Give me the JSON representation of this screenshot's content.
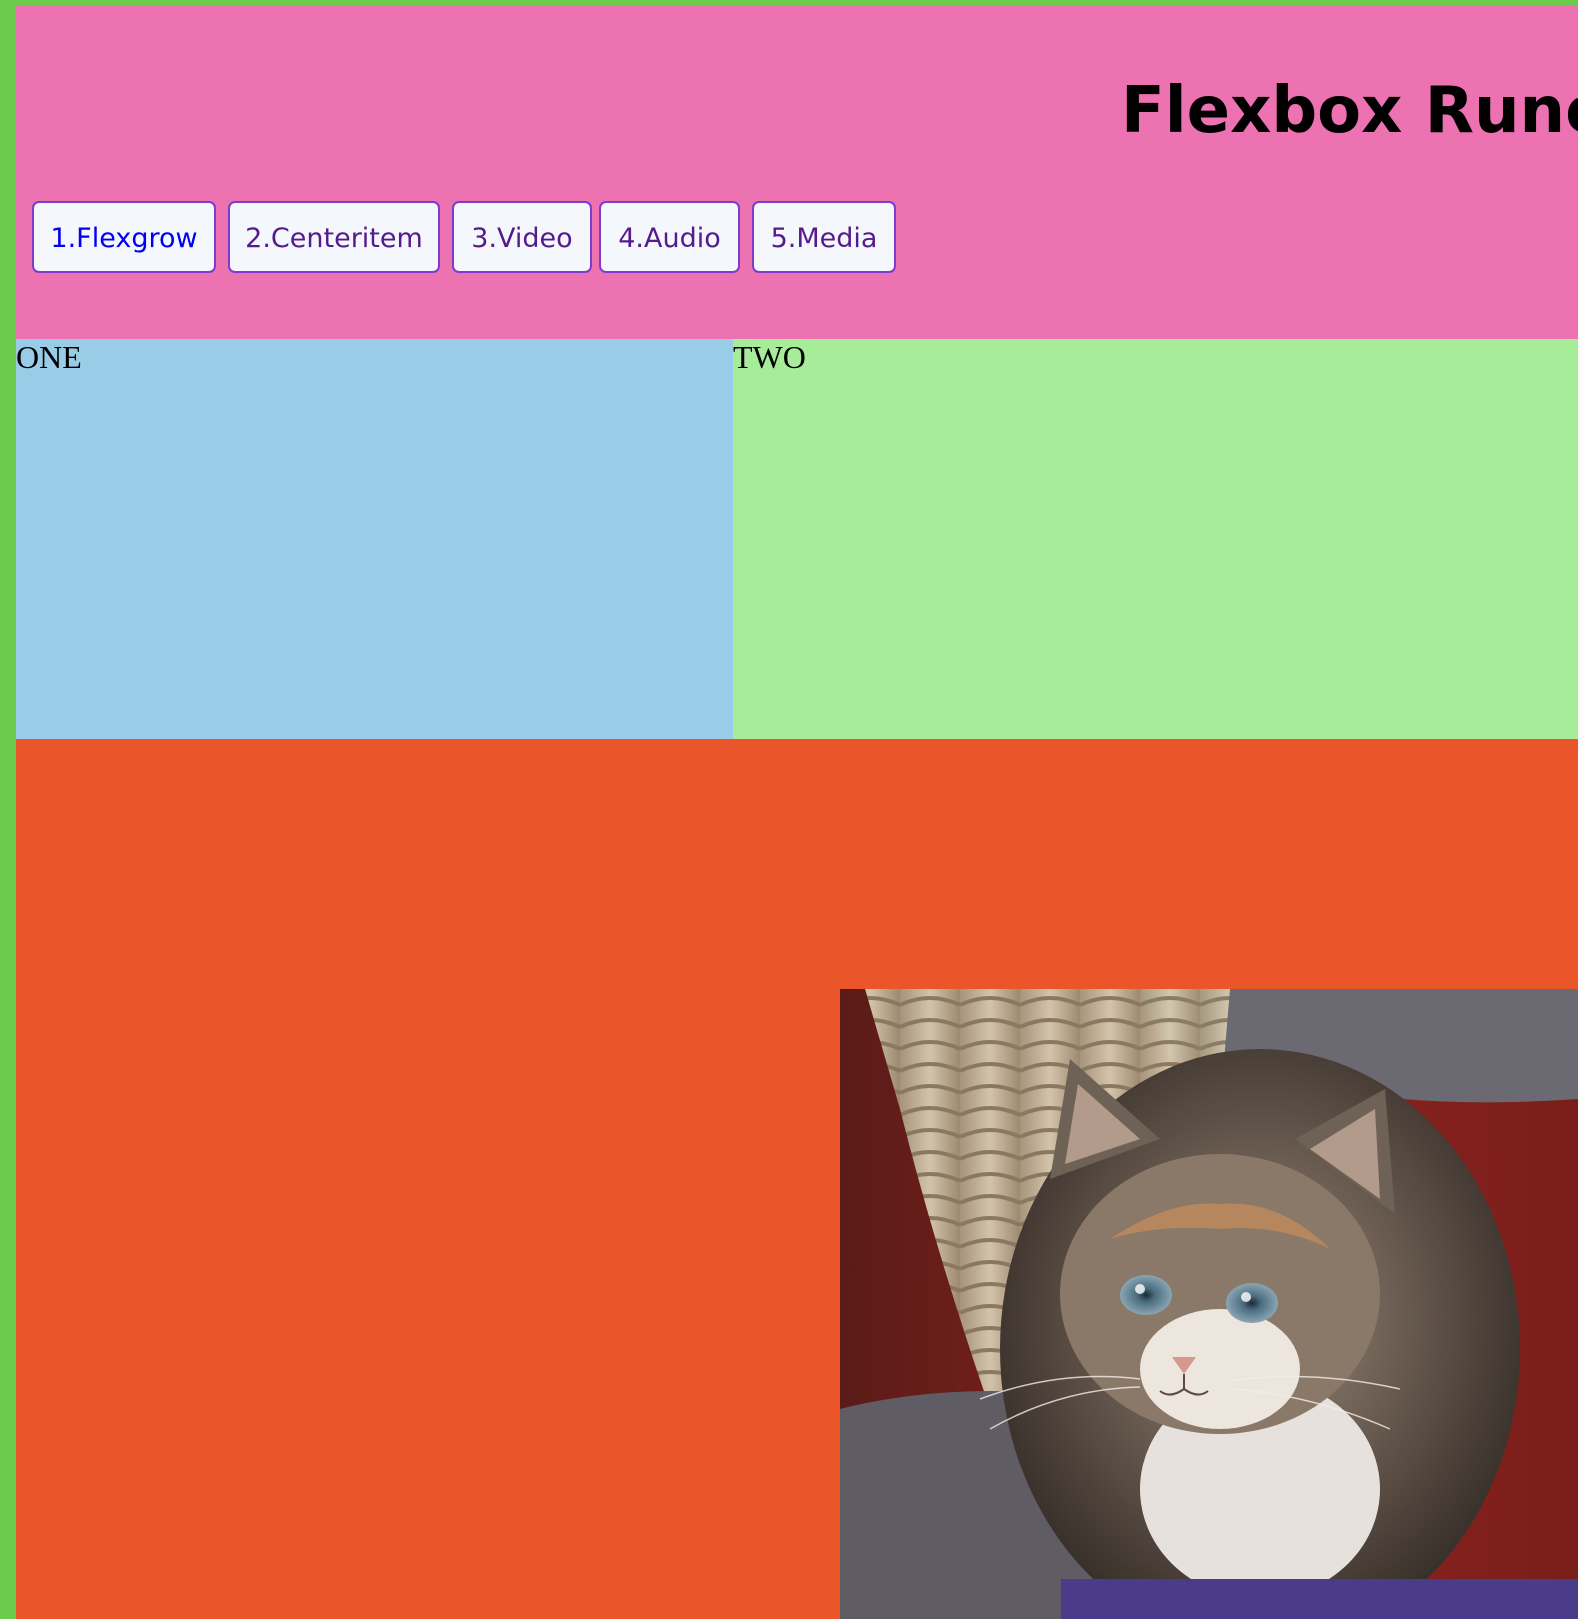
{
  "header": {
    "title": "Flexbox Rune",
    "nav": [
      {
        "label": "1.Flexgrow",
        "state": "link"
      },
      {
        "label": "2.Centeritem",
        "state": "visited"
      },
      {
        "label": "3.Video",
        "state": "visited"
      },
      {
        "label": "4.Audio",
        "state": "visited"
      },
      {
        "label": "5.Media",
        "state": "visited"
      }
    ]
  },
  "boxes": {
    "one_label": "ONE",
    "two_label": "TWO"
  },
  "media": {
    "image": "kitten-photo"
  },
  "colors": {
    "page_border": "#6acb4c",
    "header_bg": "#ed72b1",
    "box_one_bg": "#99cce7",
    "box_two_bg": "#a7ec99",
    "media_bg": "#ea5629",
    "caption_bg": "#4a3c88",
    "button_border": "#7d3ccd",
    "button_bg": "#f4f8fd",
    "link": "#0000ee",
    "visited": "#551a8b"
  }
}
